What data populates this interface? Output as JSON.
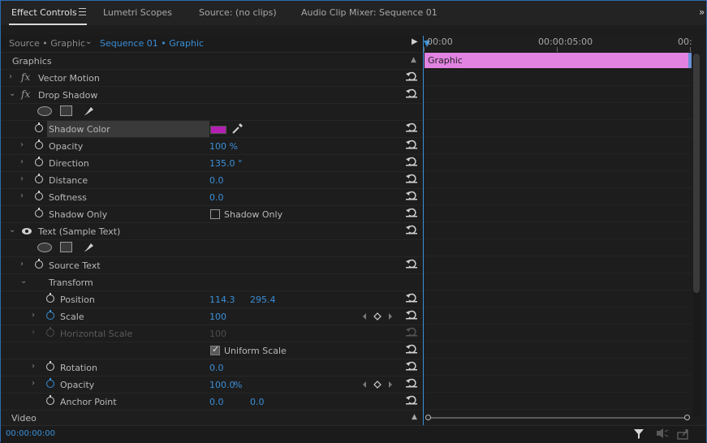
{
  "tabs": [
    {
      "label": "Effect Controls",
      "active": true
    },
    {
      "label": "Lumetri Scopes"
    },
    {
      "label": "Source: (no clips)"
    },
    {
      "label": "Audio Clip Mixer: Sequence 01"
    }
  ],
  "header": {
    "source_label": "Source • Graphic",
    "sequence_label": "Sequence 01 • Graphic"
  },
  "sections": {
    "graphics": "Graphics",
    "video": "Video"
  },
  "effects": {
    "vector_motion": "Vector Motion",
    "drop_shadow": "Drop Shadow",
    "shadow_color": "Shadow Color",
    "shadow_color_hex": "#b31eb3",
    "opacity": {
      "label": "Opacity",
      "value": "100 %"
    },
    "direction": {
      "label": "Direction",
      "value": "135.0 °"
    },
    "distance": {
      "label": "Distance",
      "value": "0.0"
    },
    "softness": {
      "label": "Softness",
      "value": "0.0"
    },
    "shadow_only": {
      "label": "Shadow Only",
      "checkbox_label": "Shadow Only",
      "checked": false
    },
    "text_layer": "Text (Sample Text)",
    "source_text": "Source Text",
    "transform": "Transform",
    "position": {
      "label": "Position",
      "x": "114.3",
      "y": "295.4"
    },
    "scale": {
      "label": "Scale",
      "value": "100"
    },
    "horizontal_scale": {
      "label": "Horizontal Scale",
      "value": "100"
    },
    "uniform_scale": {
      "label": "Uniform Scale",
      "checked": true
    },
    "rotation": {
      "label": "Rotation",
      "value": "0.0"
    },
    "t_opacity": {
      "label": "Opacity",
      "value": "100.0",
      "unit": "%"
    },
    "anchor_point": {
      "label": "Anchor Point",
      "x": "0.0",
      "y": "0.0"
    }
  },
  "timeline": {
    "ruler": [
      "00:00",
      "00:00:05:00",
      "00:"
    ],
    "clip_label": "Graphic",
    "clip_color": "#e283e2"
  },
  "status": {
    "timecode": "00:00:00:00"
  },
  "colors": {
    "accent": "#3a8fd6",
    "text": "#b8b8b8"
  }
}
